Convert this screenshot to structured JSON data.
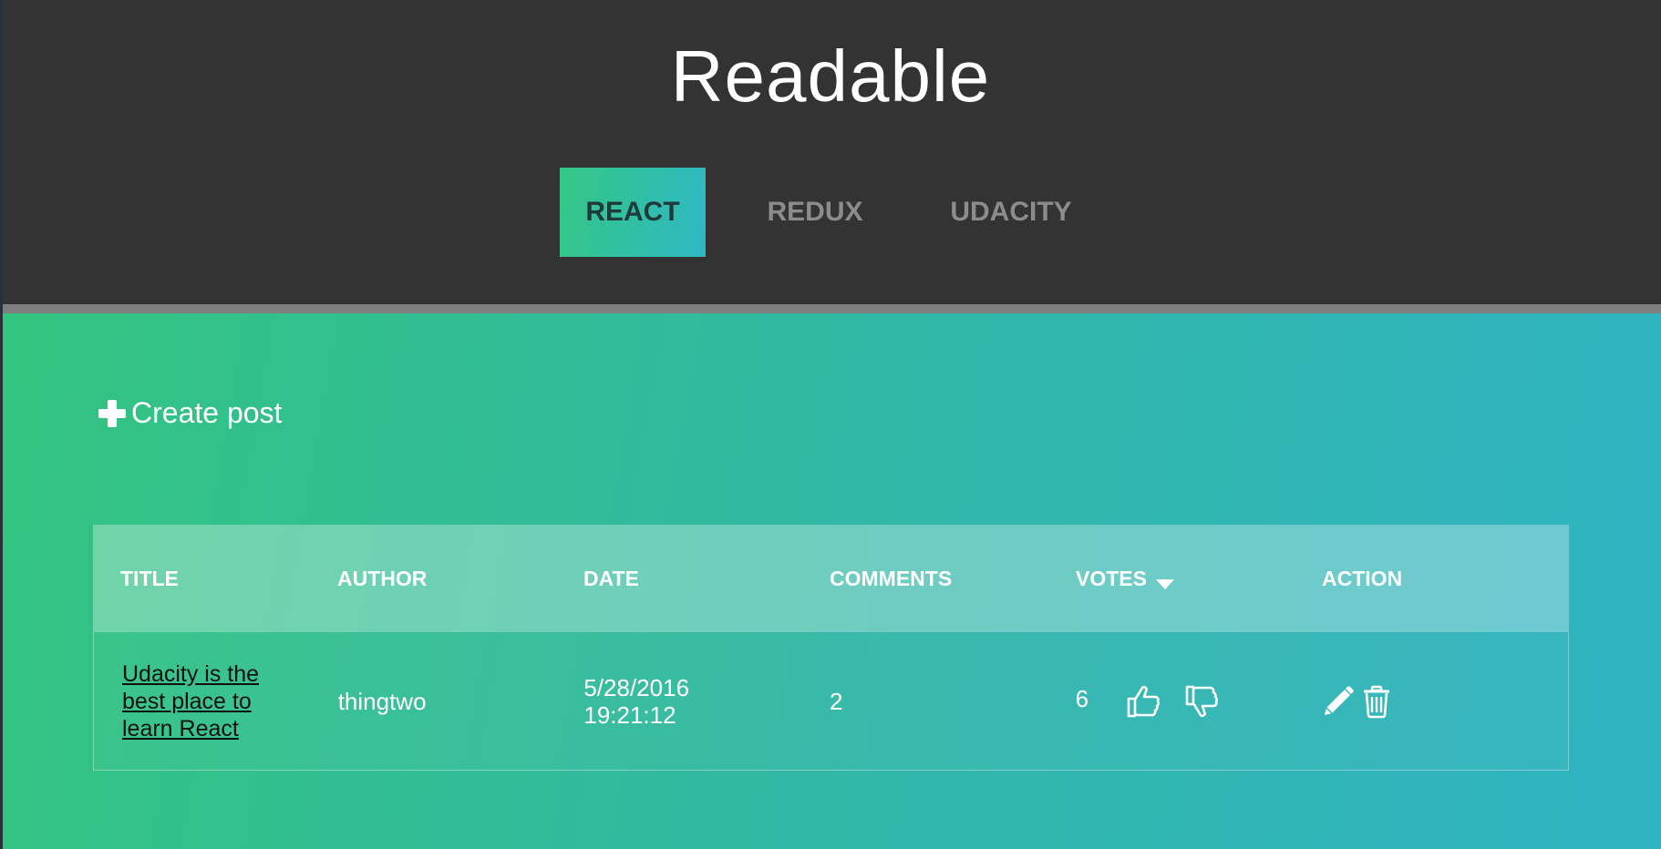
{
  "app": {
    "title": "Readable"
  },
  "categories": [
    {
      "label": "REACT",
      "active": true
    },
    {
      "label": "REDUX",
      "active": false
    },
    {
      "label": "UDACITY",
      "active": false
    }
  ],
  "create_post": {
    "label": "Create post",
    "icon": "plus-icon"
  },
  "table": {
    "headers": {
      "title": "TITLE",
      "author": "AUTHOR",
      "date": "DATE",
      "comments": "COMMENTS",
      "votes": "VOTES",
      "action": "ACTION"
    },
    "sort": {
      "column": "votes",
      "direction": "desc",
      "icon": "caret-down-icon"
    },
    "rows": [
      {
        "title": "Udacity is the best place to learn React",
        "author": "thingtwo",
        "date": "5/28/2016",
        "time": "19:21:12",
        "comments": "2",
        "votes": "6",
        "icons": [
          "thumbs-up-icon",
          "thumbs-down-icon",
          "pencil-icon",
          "trash-icon"
        ]
      }
    ]
  },
  "colors": {
    "header_bg": "#333333",
    "gradient_start": "#33c47f",
    "gradient_end": "#2fb3c2",
    "inactive_tab_text": "#8c8c8c"
  }
}
